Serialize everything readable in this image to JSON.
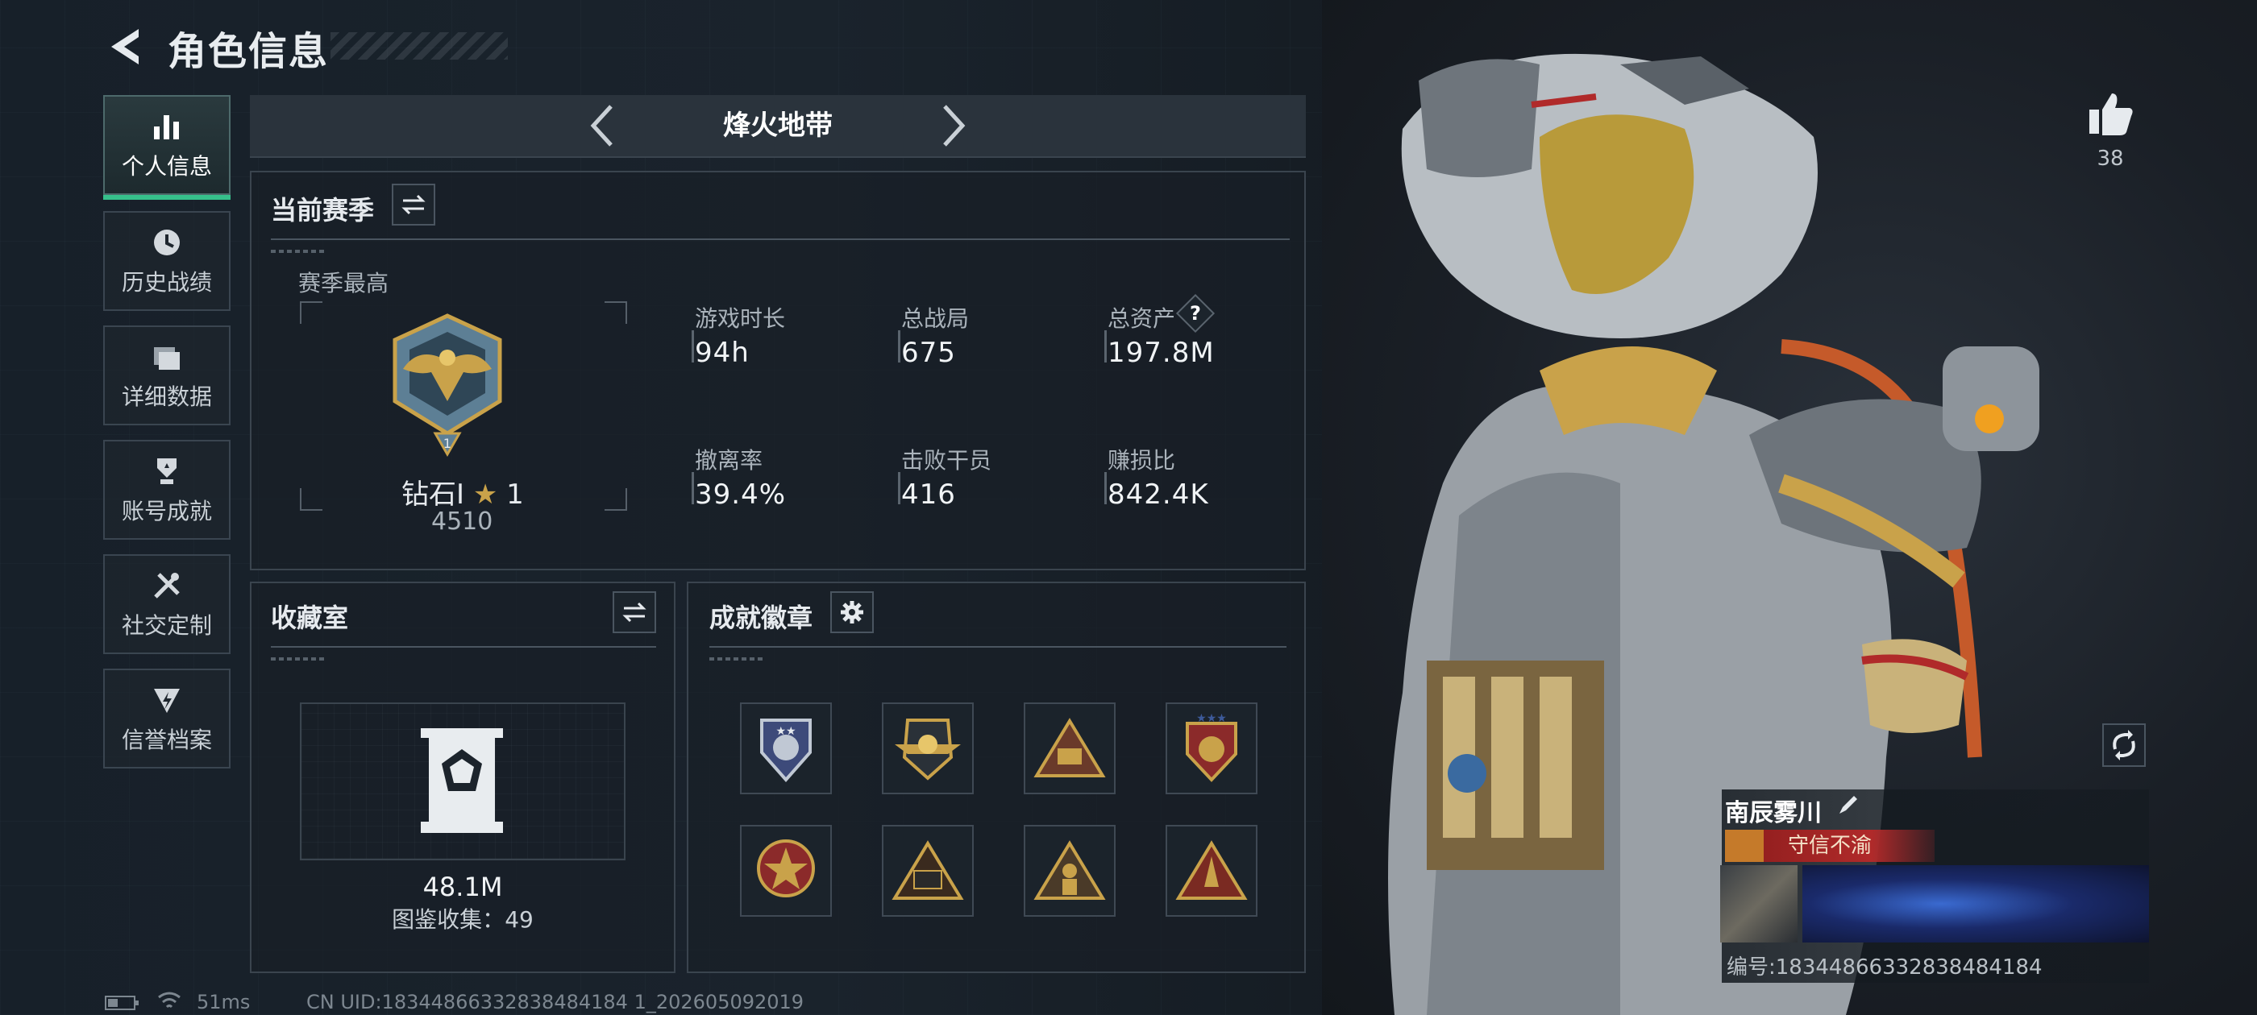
{
  "header": {
    "title": "角色信息"
  },
  "sidebar": {
    "items": [
      {
        "label": "个人信息",
        "icon": "bar-chart-icon",
        "active": true
      },
      {
        "label": "历史战绩",
        "icon": "clock-icon"
      },
      {
        "label": "详细数据",
        "icon": "folder-icon"
      },
      {
        "label": "账号成就",
        "icon": "trophy-icon"
      },
      {
        "label": "社交定制",
        "icon": "tools-icon"
      },
      {
        "label": "信誉档案",
        "icon": "shield-icon"
      }
    ]
  },
  "mode": {
    "name": "烽火地带"
  },
  "season": {
    "title": "当前赛季",
    "best_label": "赛季最高",
    "rank_name": "钻石Ⅰ",
    "rank_stars": "1",
    "rank_score": "4510",
    "stats": [
      {
        "label": "游戏时长",
        "value": "94h"
      },
      {
        "label": "总战局",
        "value": "675"
      },
      {
        "label": "总资产",
        "value": "197.8M",
        "help": "?"
      },
      {
        "label": "撤离率",
        "value": "39.4%"
      },
      {
        "label": "击败干员",
        "value": "416"
      },
      {
        "label": "赚损比",
        "value": "842.4K"
      }
    ]
  },
  "collection": {
    "title": "收藏室",
    "value": "48.1M",
    "catalog_label": "图鉴收集：",
    "catalog_count": "49"
  },
  "badges": {
    "title": "成就徽章",
    "count": 8
  },
  "character": {
    "likes": "38",
    "name": "南辰雾川",
    "banner": "守信不渝",
    "id_text": "编号:18344866332838484184"
  },
  "footer": {
    "ping": "51ms",
    "uid": "CN UID:18344866332838484184 1_202605092019"
  },
  "colors": {
    "accent_green": "#36c08b",
    "gold": "#c9a24a",
    "banner_red": "#b02a2a"
  }
}
